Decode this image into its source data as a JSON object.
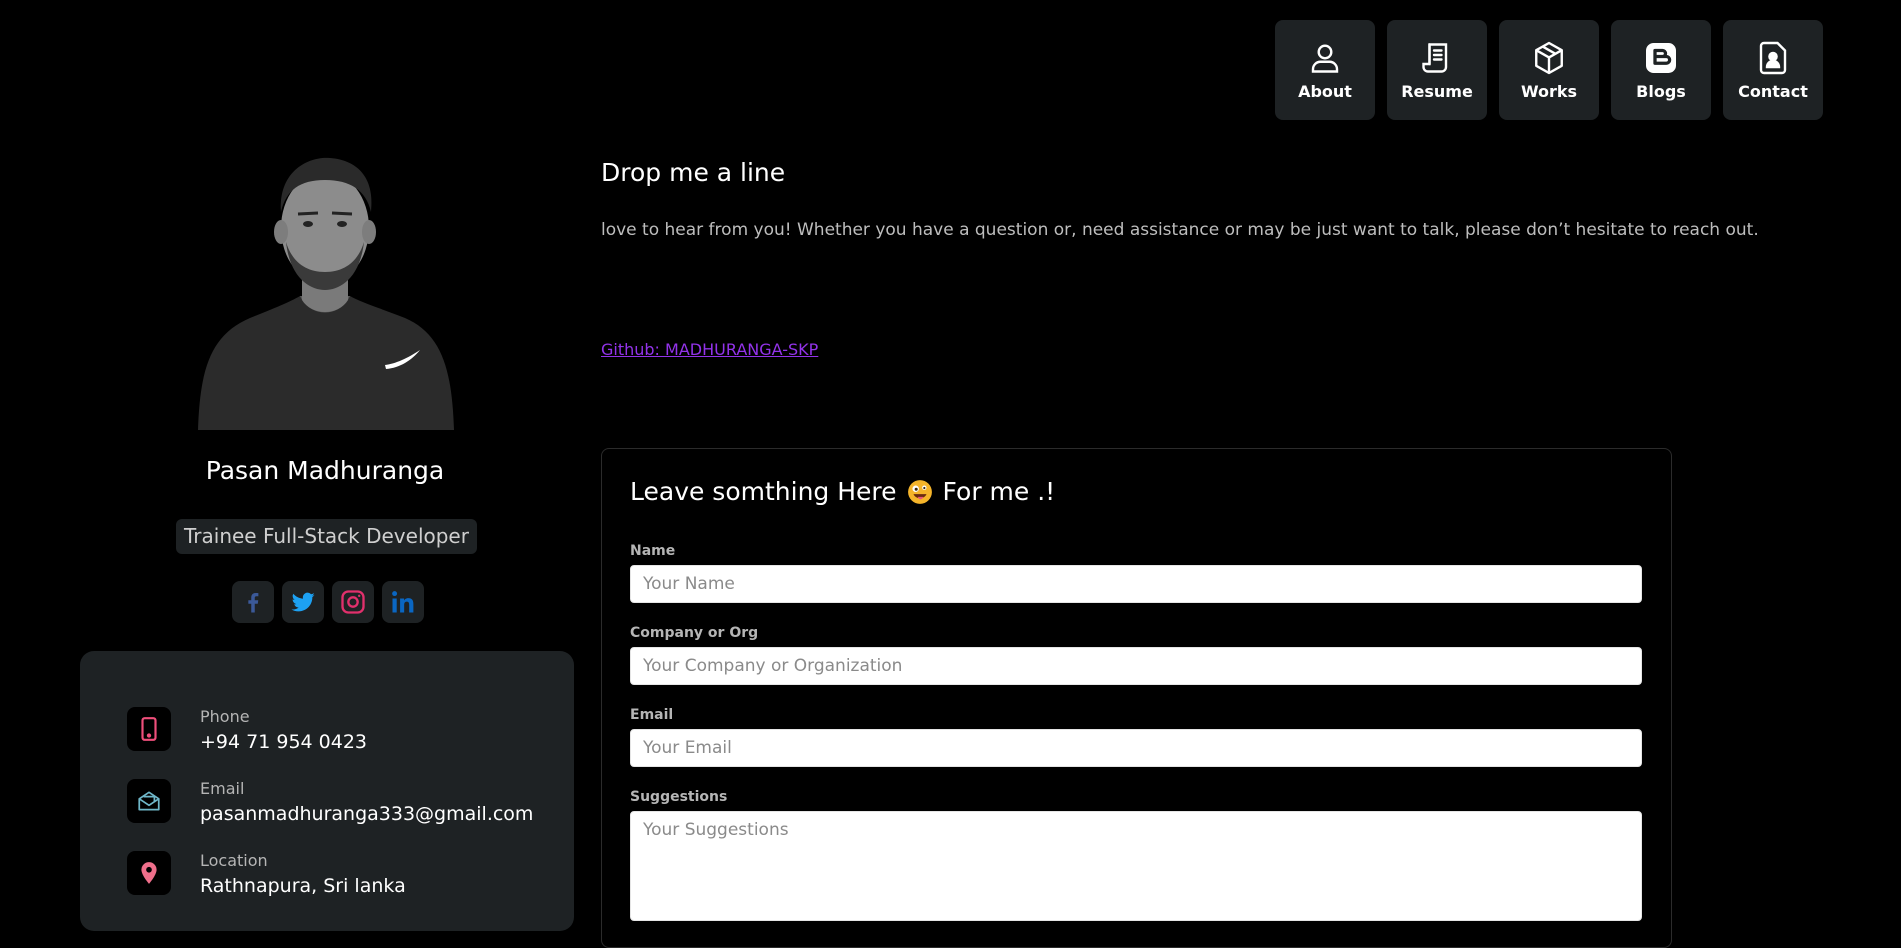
{
  "nav": {
    "items": [
      {
        "label": "About",
        "icon": "user-icon"
      },
      {
        "label": "Resume",
        "icon": "document-icon"
      },
      {
        "label": "Works",
        "icon": "box-icon"
      },
      {
        "label": "Blogs",
        "icon": "blogger-icon"
      },
      {
        "label": "Contact",
        "icon": "contact-card-icon"
      }
    ]
  },
  "profile": {
    "name": "Pasan Madhuranga",
    "role": "Trainee Full-Stack Developer",
    "socials": [
      {
        "name": "facebook",
        "color": "#3b5998"
      },
      {
        "name": "twitter",
        "color": "#1da1f2"
      },
      {
        "name": "instagram",
        "color": "#e1306c"
      },
      {
        "name": "linkedin",
        "color": "#0a66c2"
      }
    ]
  },
  "contact": {
    "phone_label": "Phone",
    "phone_value": "+94 71 954 0423",
    "email_label": "Email",
    "email_value": "pasanmadhuranga333@gmail.com",
    "location_label": "Location",
    "location_value": "Rathnapura, Sri lanka"
  },
  "main": {
    "title": "Drop me a line",
    "lead": "love to hear from you! Whether you have a question or, need assistance or may be just want to talk, please don’t hesitate to reach out.",
    "github_link": "Github: MADHURANGA-SKP"
  },
  "form": {
    "title_before": "Leave somthing Here",
    "title_after": "For me .!",
    "name_label": "Name",
    "name_placeholder": "Your Name",
    "company_label": "Company or Org",
    "company_placeholder": "Your Company or Organization",
    "email_label": "Email",
    "email_placeholder": "Your Email",
    "suggestions_label": "Suggestions",
    "suggestions_placeholder": "Your Suggestions"
  },
  "colors": {
    "background": "#000000",
    "card": "#1e2224",
    "accent_pink": "#ef4f7b",
    "link_purple": "#9333ea"
  }
}
